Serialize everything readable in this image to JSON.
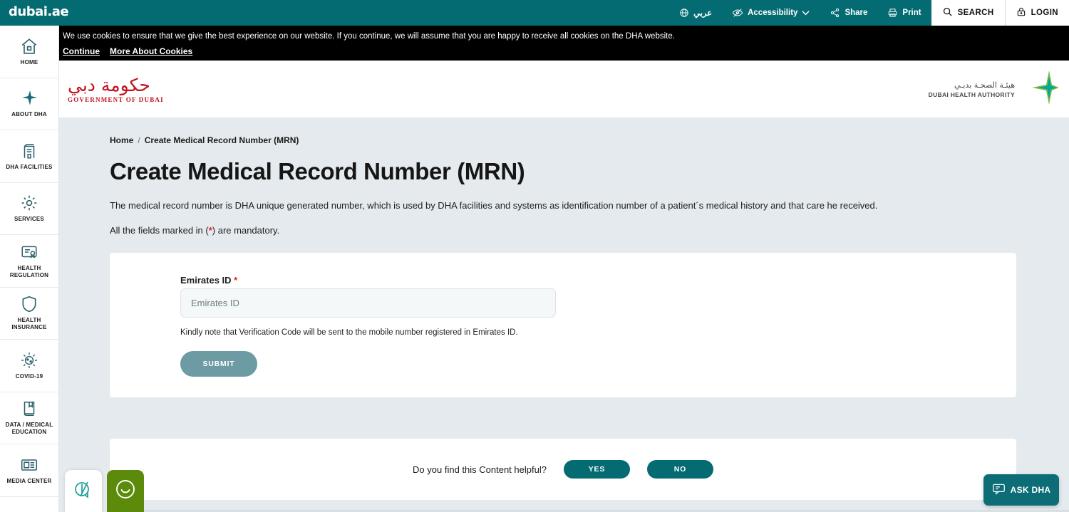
{
  "topbar": {
    "logo": "dubai.ae",
    "items": [
      {
        "icon": "globe-icon",
        "label": "عربي"
      },
      {
        "icon": "accessibility-eye-icon",
        "label": "Accessibility",
        "chevron": "chevron-down-icon"
      },
      {
        "icon": "share-icon",
        "label": "Share"
      },
      {
        "icon": "print-icon",
        "label": "Print"
      }
    ],
    "search_label": "SEARCH",
    "login_label": "LOGIN",
    "bg_color": "#056b72"
  },
  "cookie": {
    "text": "We use cookies to ensure that we give the best experience on our website. If you continue, we will assume that you are happy to receive all cookies on the DHA website.",
    "continue_label": "Continue",
    "more_label": "More About Cookies"
  },
  "sidebar": {
    "items": [
      {
        "icon": "home-icon",
        "label": "HOME"
      },
      {
        "icon": "sparkle-star-icon",
        "label": "ABOUT DHA"
      },
      {
        "icon": "building-icon",
        "label": "DHA FACILITIES"
      },
      {
        "icon": "gear-icon",
        "label": "SERVICES"
      },
      {
        "icon": "certificate-icon",
        "label": "HEALTH REGULATION"
      },
      {
        "icon": "shield-icon",
        "label": "HEALTH INSURANCE"
      },
      {
        "icon": "virus-icon",
        "label": "COVID-19"
      },
      {
        "icon": "book-icon",
        "label": "DATA / MEDICAL EDUCATION"
      },
      {
        "icon": "newspaper-icon",
        "label": "MEDIA CENTER"
      }
    ]
  },
  "header": {
    "gov_logo_arabic": "حكومة دبي",
    "gov_logo_english": "GOVERNMENT OF DUBAI",
    "gov_logo_color": "#c1121f",
    "dha_logo_arabic": "هيئـة الصحـة بدبـي",
    "dha_logo_english": "DUBAI HEALTH AUTHORITY",
    "dha_star_colors": [
      "#7fbc42",
      "#00a79d"
    ]
  },
  "breadcrumb": {
    "home": "Home",
    "separator": "/",
    "current": "Create Medical Record Number (MRN)"
  },
  "main": {
    "title": "Create Medical Record Number (MRN)",
    "paragraph": "The medical record number is DHA unique generated number, which is used by DHA facilities and systems as identification number of a patient´s medical history and that care he received.",
    "mandatory_pre": "All the fields marked in (",
    "mandatory_star": "*",
    "mandatory_post": ") are mandatory."
  },
  "form": {
    "label": "Emirates ID",
    "required_mark": "*",
    "placeholder": "Emirates ID",
    "value": "",
    "note": "Kindly note that Verification Code will be sent to the mobile number registered in Emirates ID.",
    "submit_label": "SUBMIT",
    "submit_color": "#6c9ba4"
  },
  "feedback": {
    "question": "Do you find this Content helpful?",
    "yes_label": "YES",
    "no_label": "NO",
    "button_color": "#046b72"
  },
  "widgets": {
    "accessibility_icon": "accessibility-widget-icon",
    "smiley_icon": "smiley-face-icon",
    "smiley_bg": "#5c8a0a",
    "ask_dha_label": "ASK DHA",
    "ask_dha_icon": "chat-bubble-icon",
    "ask_dha_color": "#0c6d76"
  }
}
